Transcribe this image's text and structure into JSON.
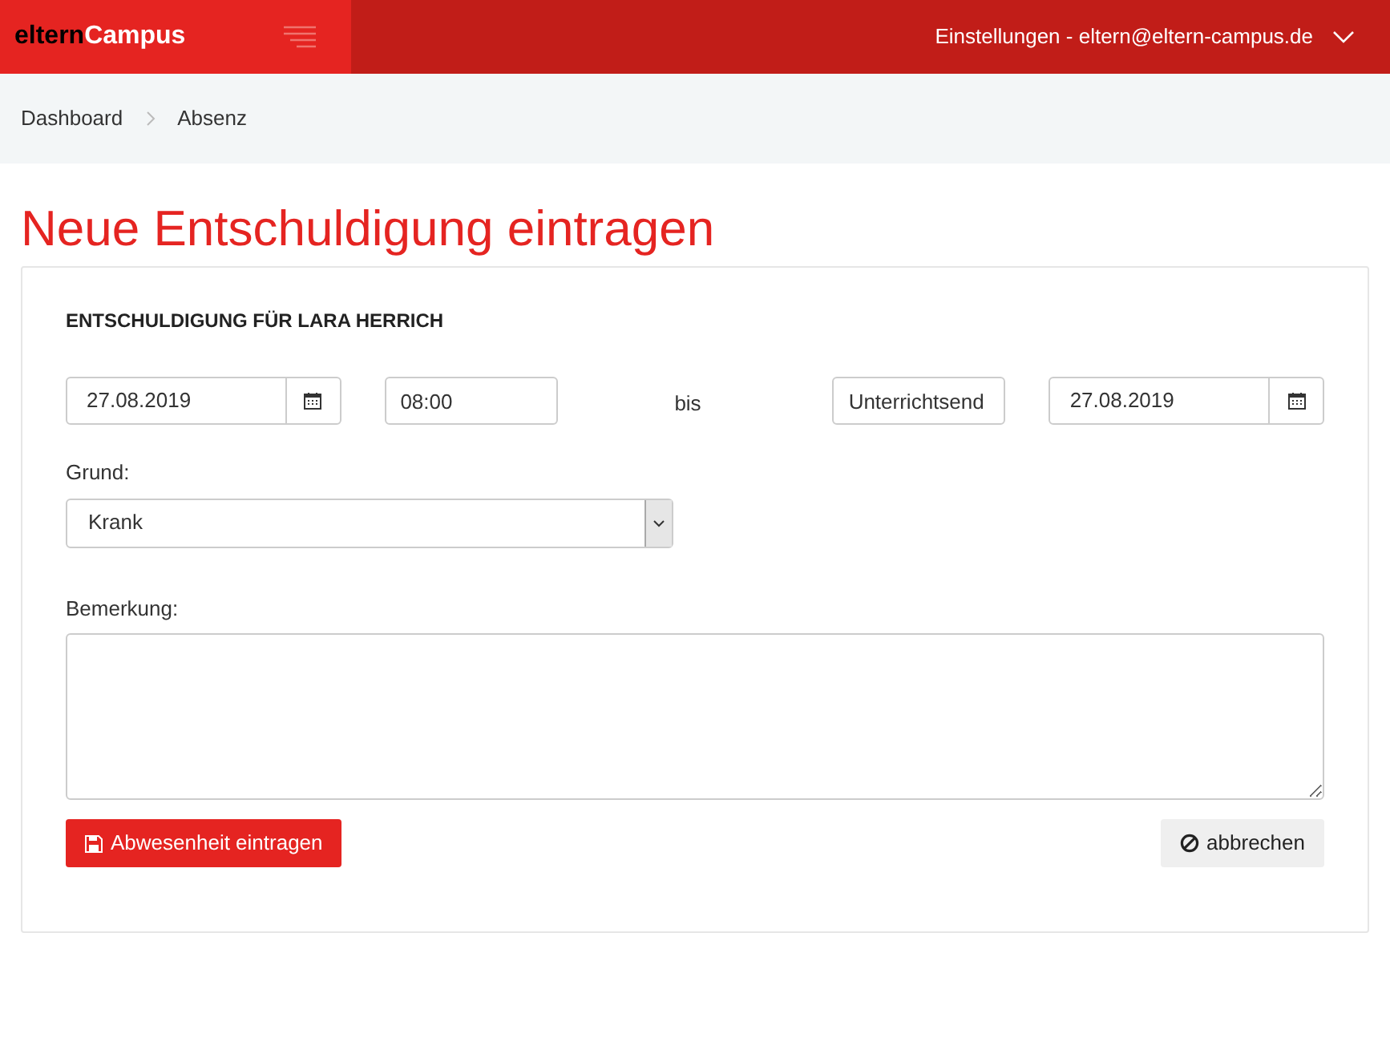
{
  "header": {
    "logo": {
      "part_1": "eltern",
      "part_2": "Campus"
    },
    "user_menu": "Einstellungen - eltern@eltern-campus.de"
  },
  "breadcrumb": [
    "Dashboard",
    "Absenz"
  ],
  "page_title": "Neue Entschuldigung eintragen",
  "form": {
    "heading": "ENTSCHULDIGUNG FÜR LARA HERRICH",
    "from_date": "27.08.2019",
    "from_time": "08:00",
    "separator": "bis",
    "to_time": "Unterrichtsend",
    "to_date": "27.08.2019",
    "reason_label": "Grund:",
    "reason_value": "Krank",
    "remark_label": "Bemerkung:",
    "submit_button": "Abwesenheit eintragen",
    "cancel_button": "abbrechen"
  }
}
